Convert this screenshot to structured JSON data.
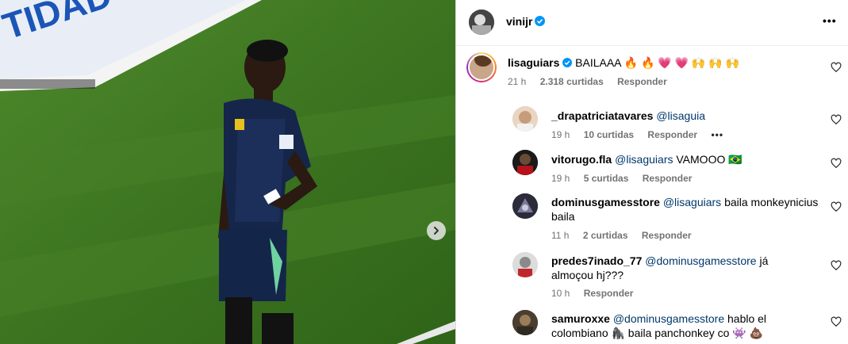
{
  "post": {
    "author": "vinijr",
    "more_label": "•••"
  },
  "main_comment": {
    "user": "lisaguiars",
    "text": "BAILAAA 🔥 🔥 💗 💗 🙌 🙌 🙌",
    "time": "21 h",
    "likes": "2.318 curtidas",
    "reply": "Responder"
  },
  "replies": [
    {
      "user": "_drapatriciatavares",
      "mention": "@lisaguia",
      "text": "",
      "time": "19 h",
      "likes": "10 curtidas",
      "reply": "Responder",
      "more": "•••"
    },
    {
      "user": "vitorugo.fla",
      "mention": "@lisaguiars",
      "text": " VAMOOO 🇧🇷",
      "time": "19 h",
      "likes": "5 curtidas",
      "reply": "Responder"
    },
    {
      "user": "dominusgamesstore",
      "mention": "@lisaguiars",
      "text": " baila monkeynicius baila",
      "time": "11 h",
      "likes": "2 curtidas",
      "reply": "Responder"
    },
    {
      "user": "predes7inado_77",
      "mention": "@dominusgamesstore",
      "text": " já almoçou hj???",
      "time": "10 h",
      "likes": "",
      "reply": "Responder"
    },
    {
      "user": "samuroxxe",
      "mention": "@dominusgamesstore",
      "text": " hablo el colombiano 🦍 baila panchonkey co 👾 💩",
      "time": "",
      "likes": "",
      "reply": ""
    }
  ],
  "colors": {
    "verified": "#0095f6",
    "mention": "#00376b",
    "meta": "#737373"
  }
}
